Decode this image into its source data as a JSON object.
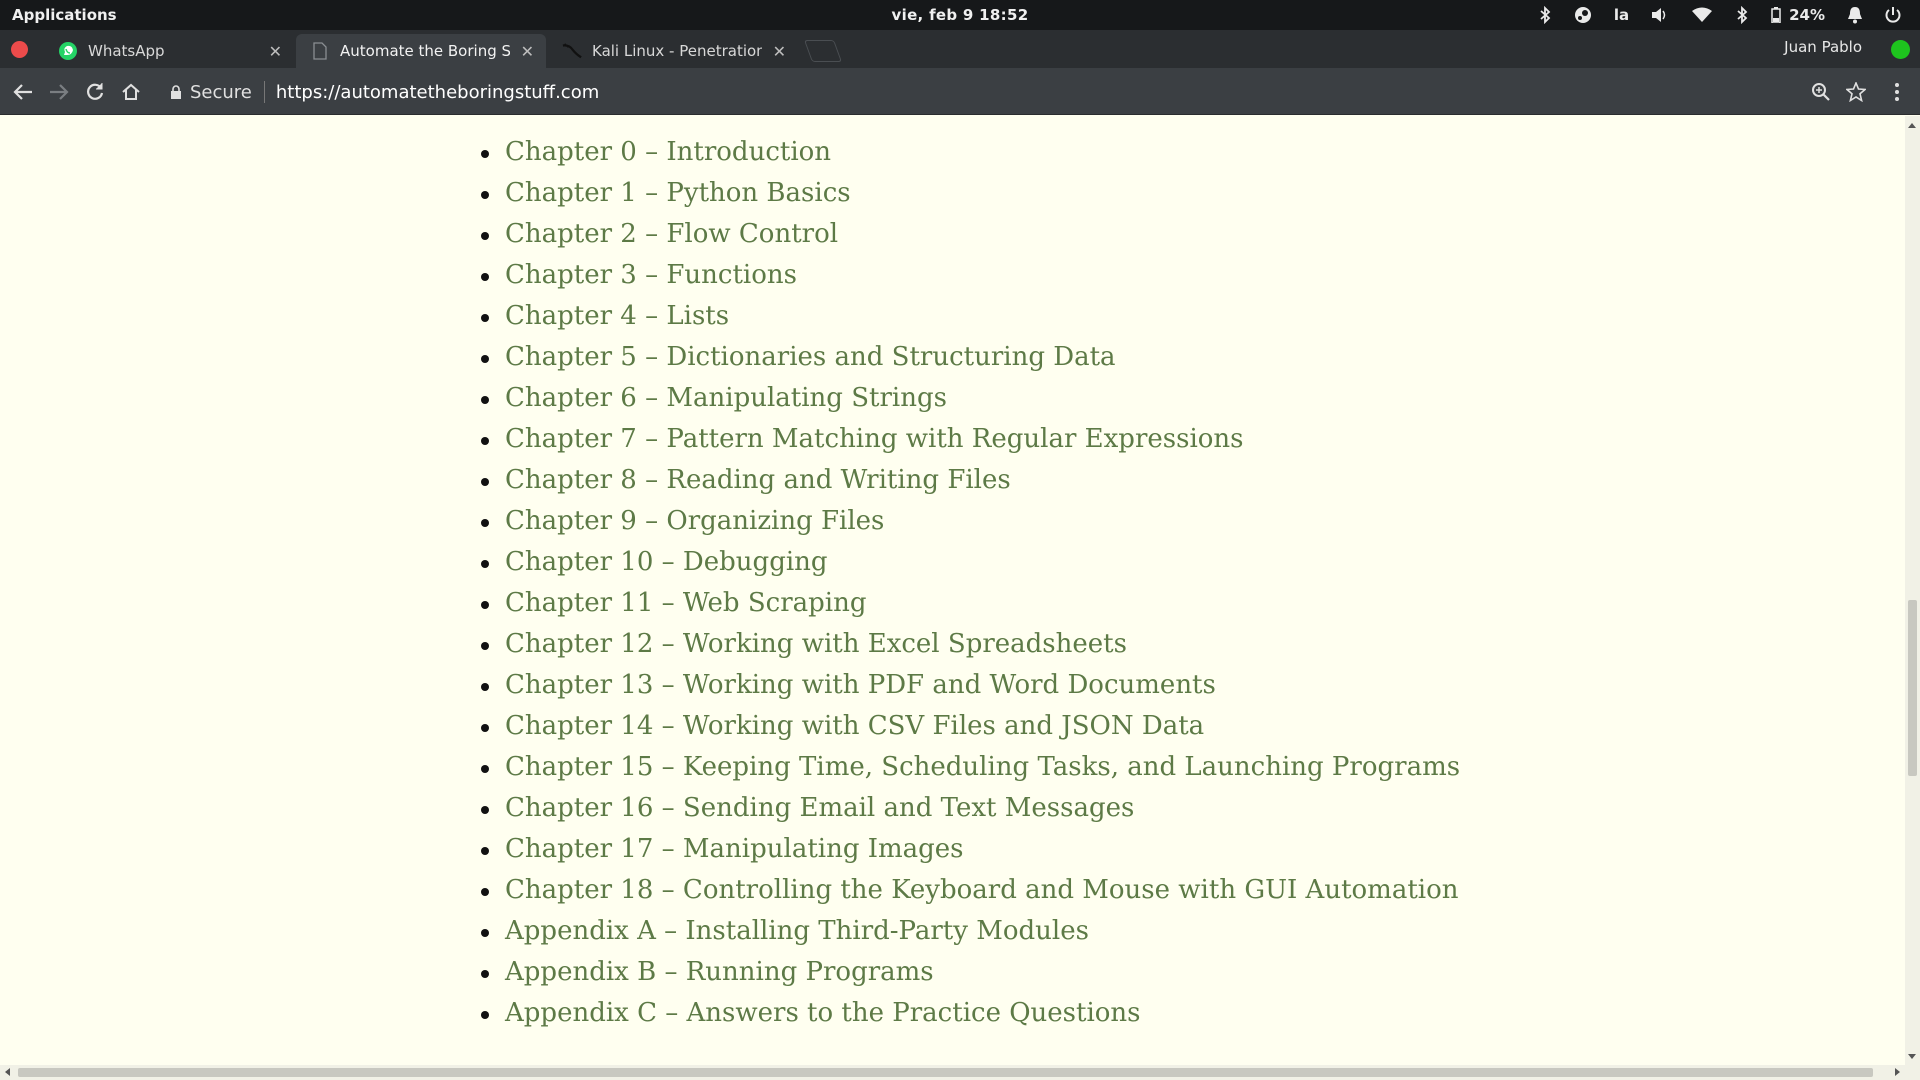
{
  "system_panel": {
    "applications_label": "Applications",
    "clock": "vie, feb  9   18:52",
    "keyboard_layout": "la",
    "battery_percent": "24%"
  },
  "tabs": [
    {
      "title": "WhatsApp",
      "icon": "whatsapp-icon",
      "active": false
    },
    {
      "title": "Automate the Boring Stuff",
      "icon": "document-icon",
      "active": true
    },
    {
      "title": "Kali Linux - Penetration",
      "icon": "kali-dragon-icon",
      "active": false
    }
  ],
  "profile": {
    "name": "Juan Pablo",
    "status_color": "#1ec41e"
  },
  "toolbar": {
    "secure_label": "Secure",
    "url": "https://automatetheboringstuff.com"
  },
  "toc": [
    "Chapter 0 – Introduction",
    "Chapter 1 – Python Basics",
    "Chapter 2 – Flow Control",
    "Chapter 3 – Functions",
    "Chapter 4 – Lists",
    "Chapter 5 – Dictionaries and Structuring Data",
    "Chapter 6 – Manipulating Strings",
    "Chapter 7 – Pattern Matching with Regular Expressions",
    "Chapter 8 – Reading and Writing Files",
    "Chapter 9 – Organizing Files",
    "Chapter 10 – Debugging",
    "Chapter 11 – Web Scraping",
    "Chapter 12 – Working with Excel Spreadsheets",
    "Chapter 13 – Working with PDF and Word Documents",
    "Chapter 14 – Working with CSV Files and JSON Data",
    "Chapter 15 – Keeping Time, Scheduling Tasks, and Launching Programs",
    "Chapter 16 – Sending Email and Text Messages",
    "Chapter 17 – Manipulating Images",
    "Chapter 18 – Controlling the Keyboard and Mouse with GUI Automation",
    "Appendix A – Installing Third-Party Modules",
    "Appendix B – Running Programs",
    "Appendix C – Answers to the Practice Questions"
  ],
  "colors": {
    "link": "#5d7a46",
    "page_background": "#fffff0",
    "window_close": "#ec4b4b"
  }
}
